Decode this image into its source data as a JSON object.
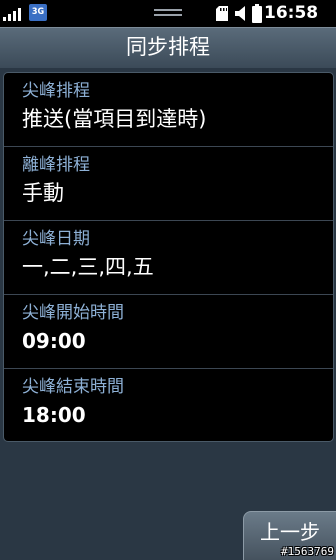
{
  "status_bar": {
    "network_badge": "3G",
    "time": "16:58",
    "icons": [
      "signal-icon",
      "network-3g-icon",
      "drag-handle-icon",
      "sd-card-icon",
      "vibrate-icon",
      "battery-icon"
    ]
  },
  "title_bar": {
    "title": "同步排程"
  },
  "settings": [
    {
      "label": "尖峰排程",
      "value": "推送(當項目到達時)"
    },
    {
      "label": "離峰排程",
      "value": "手動"
    },
    {
      "label": "尖峰日期",
      "value": "一,二,三,四,五"
    },
    {
      "label": "尖峰開始時間",
      "value": "09:00"
    },
    {
      "label": "尖峰結束時間",
      "value": "18:00"
    }
  ],
  "footer": {
    "back_label": "上一步"
  },
  "watermark": "#1563769",
  "colors": {
    "background": "#2a3744",
    "label": "#8eb1d6",
    "value": "#ffffff",
    "card": "#000000"
  }
}
